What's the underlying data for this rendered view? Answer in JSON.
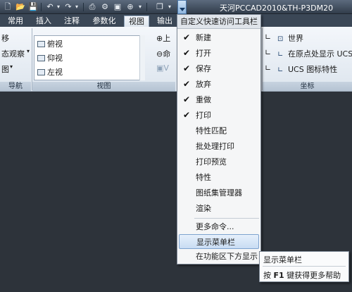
{
  "app": {
    "title": "天河PCCAD2010&TH-P3DM20"
  },
  "quick_access": {
    "icons": [
      "new-icon",
      "open-icon",
      "save-icon",
      "undo-icon",
      "redo-icon",
      "print-icon",
      "publish-icon",
      "plot-icon",
      "zoom-icon",
      "window-icon",
      "dropdown-icon"
    ]
  },
  "tabs": [
    {
      "label": "常用"
    },
    {
      "label": "插入"
    },
    {
      "label": "注释"
    },
    {
      "label": "参数化"
    },
    {
      "label": "视图"
    },
    {
      "label": "输出"
    }
  ],
  "ribbon": {
    "left_items": [
      "移",
      "态观察",
      "图"
    ],
    "nav_label": "导航",
    "views": [
      "俯视",
      "仰视",
      "左视"
    ],
    "view_panel_label": "视图",
    "mid_items": [
      "上",
      "命"
    ],
    "coords": [
      "世界",
      "在原点处显示 UCS",
      "UCS 图标特性"
    ],
    "coord_panel_label": "坐标"
  },
  "menu": {
    "header": "自定义快速访问工具栏",
    "items": [
      {
        "label": "新建",
        "checked": true
      },
      {
        "label": "打开",
        "checked": true
      },
      {
        "label": "保存",
        "checked": true
      },
      {
        "label": "放弃",
        "checked": true
      },
      {
        "label": "重做",
        "checked": true
      },
      {
        "label": "打印",
        "checked": true
      },
      {
        "label": "特性匹配",
        "checked": false
      },
      {
        "label": "批处理打印",
        "checked": false
      },
      {
        "label": "打印预览",
        "checked": false
      },
      {
        "label": "特性",
        "checked": false
      },
      {
        "label": "图纸集管理器",
        "checked": false
      },
      {
        "label": "渲染",
        "checked": false
      },
      {
        "label": "更多命令...",
        "checked": false
      },
      {
        "label": "显示菜单栏",
        "checked": false
      },
      {
        "label": "在功能区下方显示",
        "checked": false
      }
    ],
    "check_glyph": "✔"
  },
  "tooltip": {
    "title": "显示菜单栏",
    "prefix": "按 ",
    "key": "F1",
    "suffix": " 键获得更多帮助"
  }
}
